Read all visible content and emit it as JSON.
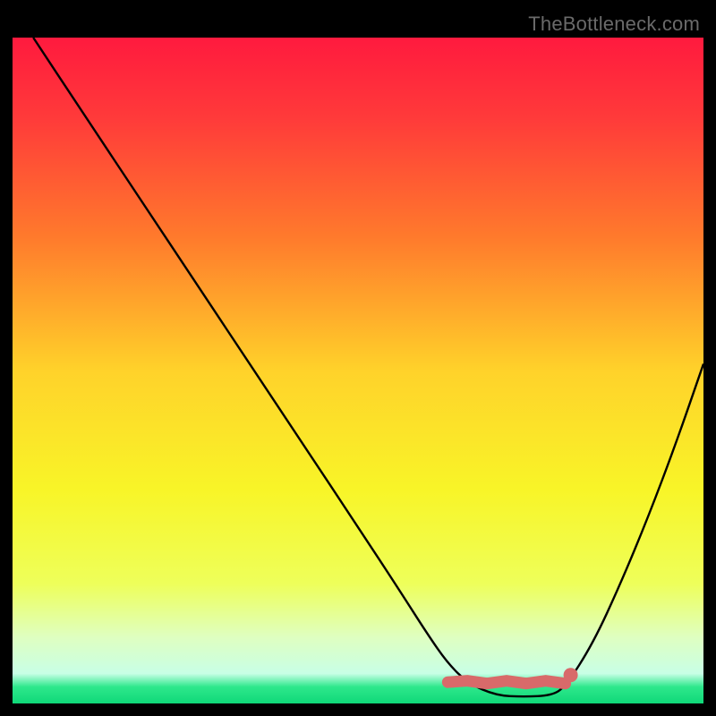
{
  "watermark": "TheBottleneck.com",
  "chart_data": {
    "type": "line",
    "title": "",
    "xlabel": "",
    "ylabel": "",
    "xlim": [
      0,
      100
    ],
    "ylim": [
      0,
      100
    ],
    "grid": false,
    "legend": false,
    "background_gradient": {
      "stops": [
        {
          "offset": 0.0,
          "color": "#ff1a3e"
        },
        {
          "offset": 0.12,
          "color": "#ff3a3a"
        },
        {
          "offset": 0.3,
          "color": "#ff7a2c"
        },
        {
          "offset": 0.5,
          "color": "#ffd22a"
        },
        {
          "offset": 0.68,
          "color": "#f8f528"
        },
        {
          "offset": 0.82,
          "color": "#eeff5a"
        },
        {
          "offset": 0.9,
          "color": "#dfffc0"
        },
        {
          "offset": 0.955,
          "color": "#c8ffe6"
        },
        {
          "offset": 0.975,
          "color": "#2ee88c"
        },
        {
          "offset": 1.0,
          "color": "#0fd878"
        }
      ]
    },
    "curve": {
      "name": "bottleneck-curve",
      "color": "#000000",
      "x": [
        3,
        10,
        18,
        26,
        34,
        42,
        50,
        56,
        60,
        63,
        66,
        70,
        74,
        78,
        80,
        84,
        88,
        92,
        96,
        100
      ],
      "y": [
        100,
        89,
        76.5,
        64,
        51.5,
        39,
        26.5,
        17,
        10.5,
        6,
        3,
        1.2,
        1,
        1.2,
        2.5,
        9,
        18,
        28,
        39,
        51
      ]
    },
    "overlay_band": {
      "name": "optimal-range",
      "color": "#d86a6a",
      "x_start": 63,
      "x_end": 80,
      "y": 3.2
    },
    "overlay_marker": {
      "name": "endpoint-marker",
      "color": "#d86a6a",
      "x": 80,
      "y": 3.2,
      "r": 1.2
    }
  }
}
